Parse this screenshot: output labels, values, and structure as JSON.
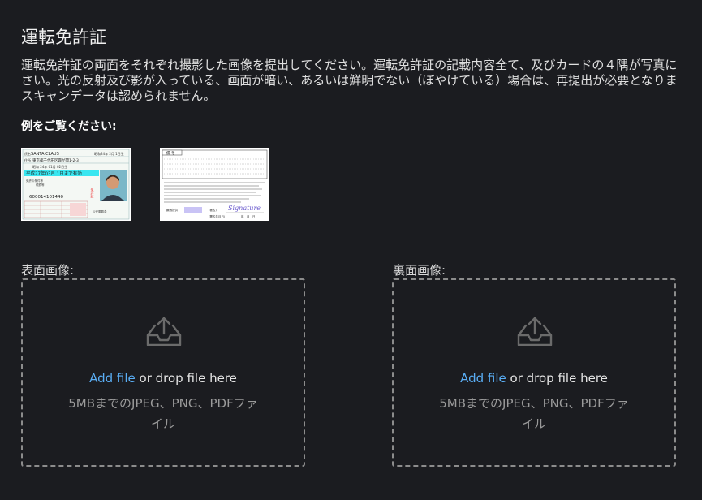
{
  "page": {
    "title": "運転免許証",
    "description_lines": [
      "運転免許証の両面をそれぞれ撮影した画像を提出してください。運転免許証の記載内容全て、及びカードの４隅が写真に",
      "さい。光の反射及び影が入っている、画面が暗い、あるいは鮮明でない（ぼやけている）場合は、再提出が必要となりま",
      "スキャンデータは認められません。"
    ],
    "examples_label": "例をご覧ください:"
  },
  "examples": {
    "front": {
      "name": "SANTA CLAUS",
      "address": "東京都千代田区霞が関1-2-3",
      "birth": "昭和 24年 01月 02日生",
      "valid": "平成27年03月 1日まで有効",
      "number": "600014101440",
      "side_text": "免許証"
    },
    "back": {
      "header": "備 考",
      "signature": "Signature"
    }
  },
  "upload": {
    "front": {
      "label": "表面画像:",
      "add_file": "Add file",
      "drop_text": " or drop file here",
      "hint": "5MBまでのJPEG、PNG、PDFファイル",
      "icon": "upload-tray-icon"
    },
    "back": {
      "label": "裏面画像:",
      "add_file": "Add file",
      "drop_text": " or drop file here",
      "hint": "5MBまでのJPEG、PNG、PDFファイル",
      "icon": "upload-tray-icon"
    }
  },
  "colors": {
    "background": "#1b1c20",
    "link": "#5aaef5",
    "dashed_border": "#8c8c8c"
  }
}
